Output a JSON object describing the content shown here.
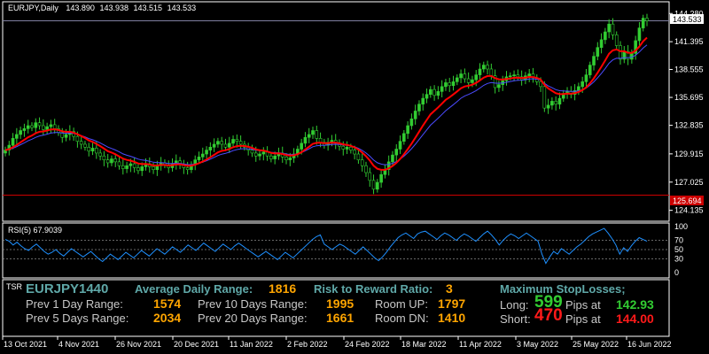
{
  "header": {
    "symbol": "EURJPY,Daily",
    "open": "143.890",
    "high": "143.938",
    "low": "143.515",
    "close": "143.533"
  },
  "price_axis": {
    "ticks": [
      "144.280",
      "141.395",
      "138.555",
      "135.695",
      "132.835",
      "129.915",
      "127.025",
      "124.135"
    ],
    "current_price_label": "143.533",
    "line_label": "125.694"
  },
  "rsi": {
    "label": "RSI(5) 67.9039",
    "ticks": [
      "100",
      "70",
      "50",
      "30",
      "0"
    ]
  },
  "time_axis": {
    "labels": [
      "13 Oct 2021",
      "4 Nov 2021",
      "26 Nov 2021",
      "20 Dec 2021",
      "11 Jan 2022",
      "2 Feb 2022",
      "24 Feb 2022",
      "18 Mar 2022",
      "11 Apr 2022",
      "3 May 2022",
      "25 May 2022",
      "16 Jun 2022"
    ]
  },
  "info_panel": {
    "tsr_tag": "TSR",
    "symbol": "EURJPY",
    "symbol_value": "1440",
    "adr_label": "Average Daily Range:",
    "adr_value": "1816",
    "rr_label": "Risk to Reward Ratio:",
    "rr_value": "3",
    "max_sl_label": "Maximum StopLosses;",
    "prev1_label": "Prev 1 Day Range:",
    "prev1_value": "1574",
    "prev10_label": "Prev 10 Days Range:",
    "prev10_value": "1995",
    "roomup_label": "Room UP:",
    "roomup_value": "1797",
    "prev5_label": "Prev 5 Days Range:",
    "prev5_value": "2034",
    "prev20_label": "Prev 20 Days Range:",
    "prev20_value": "1661",
    "roomdn_label": "Room DN:",
    "roomdn_value": "1410",
    "long_label": "Long:",
    "long_pips": "599",
    "long_pips_at": "Pips at",
    "long_price": "142.93",
    "short_label": "Short:",
    "short_pips": "470",
    "short_pips_at": "Pips at",
    "short_price": "144.00"
  },
  "colors": {
    "background": "#000000",
    "bull_candle": "#32cd32",
    "bear_candle": "#32cd32",
    "ma_fast": "#ff0000",
    "ma_slow": "#4b4bff",
    "rsi_line": "#1e90ff",
    "hline_red": "#cc0000",
    "hline_bid": "#8080a0"
  },
  "chart_data": {
    "type": "candlestick",
    "title": "EURJPY,Daily",
    "y_range": [
      123.2,
      145.3
    ],
    "rsi_range": [
      0,
      100
    ],
    "rsi_levels": [
      70,
      50,
      30
    ],
    "series_close": [
      130.3,
      130.8,
      131.5,
      131.9,
      132.3,
      132.5,
      132.8,
      132.6,
      133.1,
      132.8,
      132.4,
      132.7,
      132.9,
      132.5,
      132.1,
      131.6,
      131.9,
      132.2,
      131.7,
      131.2,
      130.9,
      130.6,
      130.2,
      130.5,
      130.0,
      129.7,
      129.3,
      129.0,
      129.4,
      129.1,
      128.7,
      128.4,
      128.7,
      128.9,
      128.5,
      128.2,
      128.6,
      128.9,
      128.6,
      128.3,
      128.7,
      129.0,
      128.8,
      128.5,
      128.9,
      129.2,
      128.8,
      128.5,
      128.3,
      128.8,
      129.3,
      129.6,
      129.9,
      130.3,
      130.6,
      130.9,
      131.2,
      130.9,
      130.6,
      131.0,
      131.4,
      131.2,
      130.9,
      130.6,
      130.3,
      130.0,
      129.7,
      129.9,
      130.1,
      129.7,
      129.4,
      129.7,
      130.0,
      129.6,
      129.3,
      129.5,
      129.9,
      130.4,
      131.0,
      131.6,
      131.9,
      132.3,
      131.5,
      131.1,
      130.8,
      131.1,
      131.3,
      131.0,
      130.7,
      130.4,
      130.6,
      130.3,
      129.9,
      129.3,
      128.7,
      128.0,
      127.2,
      126.3,
      127.0,
      127.8,
      128.3,
      129.1,
      129.8,
      130.4,
      131.2,
      132.0,
      132.8,
      133.5,
      134.3,
      135.0,
      135.6,
      136.0,
      136.5,
      135.9,
      136.3,
      136.8,
      137.2,
      136.9,
      137.3,
      137.7,
      138.1,
      137.6,
      137.2,
      137.5,
      138.0,
      138.6,
      139.0,
      138.6,
      137.9,
      136.7,
      137.0,
      137.4,
      137.8,
      137.9,
      138.0,
      137.8,
      137.5,
      137.9,
      138.1,
      137.7,
      137.3,
      136.8,
      134.6,
      134.9,
      135.3,
      135.0,
      135.6,
      136.1,
      136.3,
      136.0,
      136.4,
      136.8,
      137.3,
      138.0,
      139.0,
      139.9,
      140.8,
      141.6,
      142.4,
      143.2,
      142.1,
      141.0,
      139.6,
      140.4,
      139.6,
      140.2,
      141.5,
      142.8,
      143.8,
      143.533
    ],
    "rsi_values": [
      72,
      68,
      60,
      66,
      58,
      52,
      48,
      56,
      62,
      54,
      46,
      40,
      44,
      50,
      42,
      36,
      44,
      52,
      46,
      40,
      34,
      40,
      46,
      38,
      30,
      24,
      32,
      40,
      34,
      28,
      36,
      44,
      38,
      32,
      40,
      48,
      42,
      36,
      44,
      52,
      46,
      40,
      48,
      56,
      50,
      44,
      52,
      60,
      54,
      48,
      56,
      64,
      58,
      52,
      46,
      54,
      62,
      56,
      50,
      58,
      64,
      58,
      52,
      46,
      40,
      34,
      40,
      46,
      40,
      34,
      28,
      36,
      44,
      38,
      32,
      40,
      48,
      56,
      64,
      72,
      78,
      82,
      62,
      56,
      50,
      56,
      62,
      58,
      52,
      46,
      40,
      48,
      56,
      48,
      40,
      32,
      26,
      34,
      44,
      56,
      66,
      76,
      82,
      86,
      80,
      74,
      84,
      88,
      90,
      84,
      78,
      72,
      80,
      86,
      82,
      76,
      70,
      78,
      84,
      80,
      74,
      68,
      76,
      84,
      90,
      82,
      72,
      60,
      70,
      78,
      84,
      80,
      74,
      80,
      86,
      80,
      74,
      68,
      40,
      20,
      34,
      46,
      40,
      52,
      46,
      40,
      48,
      56,
      62,
      70,
      78,
      84,
      88,
      92,
      96,
      86,
      74,
      60,
      40,
      54,
      46,
      58,
      68,
      76,
      72,
      68
    ]
  }
}
